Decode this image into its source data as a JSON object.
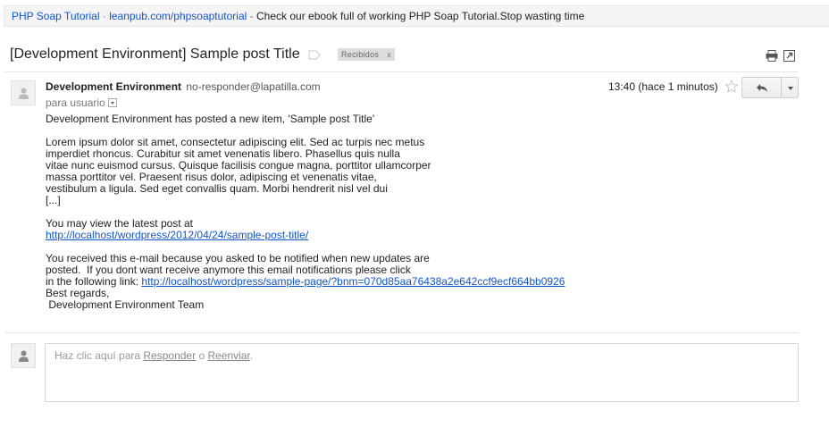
{
  "ad_bar": {
    "title": "PHP Soap Tutorial",
    "separator": "·",
    "url": "leanpub.com/phpsoaptutorial",
    "separator2": "-",
    "text": "Check our ebook full of working PHP Soap Tutorial.Stop wasting time"
  },
  "thread": {
    "subject": "[Development Environment] Sample post Title",
    "label": "Recibidos",
    "label_remove": "x",
    "icons": [
      "label-icon",
      "print-icon",
      "new-window-icon"
    ]
  },
  "message": {
    "sender_name": "Development Environment",
    "sender_email": "no-responder@lapatilla.com",
    "to_text": "para usuario",
    "timestamp": "13:40 (hace 1 minutos)",
    "body": {
      "line1": "Development Environment has posted a new item, 'Sample post Title'",
      "p1": "Lorem ipsum dolor sit amet, consectetur adipiscing elit. Sed ac turpis nec metus",
      "p2": "imperdiet rhoncus. Curabitur sit amet venenatis libero. Phasellus quis nulla",
      "p3": "vitae nunc euismod cursus. Quisque facilisis congue magna, porttitor ullamcorper",
      "p4": "massa porttitor vel. Praesent risus dolor, adipiscing et venenatis vitae,",
      "p5": "vestibulum a ligula. Sed eget convallis quam. Morbi hendrerit nisl vel dui",
      "ellipsis": "[...]",
      "view_text": "You may view the latest post at",
      "view_link": "http://localhost/wordpress/2012/04/24/sample-post-title/",
      "notice1": "You received this e-mail because you asked to be notified when new updates are",
      "notice2": "posted.  If you dont want receive anymore this email notifications please click",
      "notice3_prefix": "in the following link: ",
      "unsubscribe_link": "http://localhost/wordpress/sample-page/?bnm=070d85aa76438a2e642ccf9ecf664bb0926",
      "regards": "Best regards,",
      "team": " Development Environment Team"
    }
  },
  "reply_box": {
    "prefix": "Haz clic aquí para ",
    "reply": "Responder",
    "middle": " o ",
    "forward": "Reenviar",
    "suffix": "."
  },
  "colors": {
    "link": "#1155cc",
    "label_chip_bg": "#dddddd",
    "ad_bar_bg": "#f4f4f4"
  }
}
